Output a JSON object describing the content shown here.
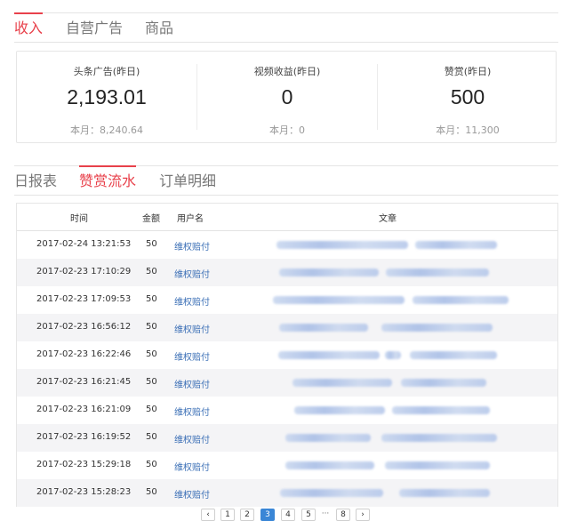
{
  "top_tabs": [
    {
      "label": "收入",
      "active": true
    },
    {
      "label": "自营广告",
      "active": false
    },
    {
      "label": "商品",
      "active": false
    }
  ],
  "summary": [
    {
      "label": "头条广告(昨日)",
      "value": "2,193.01",
      "sub": "本月：8,240.64"
    },
    {
      "label": "视频收益(昨日)",
      "value": "0",
      "sub": "本月：0"
    },
    {
      "label": "赞赏(昨日)",
      "value": "500",
      "sub": "本月：11,300"
    }
  ],
  "sub_tabs": [
    {
      "label": "日报表",
      "active": false
    },
    {
      "label": "赞赏流水",
      "active": true
    },
    {
      "label": "订单明细",
      "active": false
    }
  ],
  "table": {
    "headers": [
      "时间",
      "金额",
      "用户名",
      "文章"
    ],
    "rows": [
      {
        "time": "2017-02-24 13:21:53",
        "amount": "50",
        "user": "维权赔付"
      },
      {
        "time": "2017-02-23 17:10:29",
        "amount": "50",
        "user": "维权赔付"
      },
      {
        "time": "2017-02-23 17:09:53",
        "amount": "50",
        "user": "维权赔付"
      },
      {
        "time": "2017-02-23 16:56:12",
        "amount": "50",
        "user": "维权赔付"
      },
      {
        "time": "2017-02-23 16:22:46",
        "amount": "50",
        "user": "维权赔付"
      },
      {
        "time": "2017-02-23 16:21:45",
        "amount": "50",
        "user": "维权赔付"
      },
      {
        "time": "2017-02-23 16:21:09",
        "amount": "50",
        "user": "维权赔付"
      },
      {
        "time": "2017-02-23 16:19:52",
        "amount": "50",
        "user": "维权赔付"
      },
      {
        "time": "2017-02-23 15:29:18",
        "amount": "50",
        "user": "维权赔付"
      },
      {
        "time": "2017-02-23 15:28:23",
        "amount": "50",
        "user": "维权赔付"
      }
    ]
  },
  "pagination": {
    "prev_icon": "chevron-left-icon",
    "next_icon": "chevron-right-icon",
    "prev": "‹",
    "next": "›",
    "pages": [
      "1",
      "2",
      "3",
      "4",
      "5"
    ],
    "current": "3",
    "ellipsis": "···",
    "last": "8"
  },
  "colors": {
    "accent": "#e8414b",
    "link": "#3b6fb6",
    "page_active": "#3a86d6"
  }
}
